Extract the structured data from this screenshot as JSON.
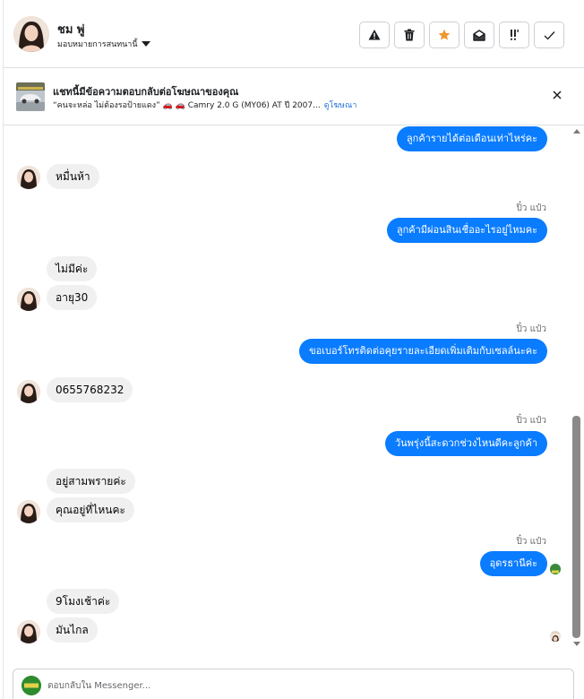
{
  "header": {
    "contact_name": "ชม พู่",
    "assign_label": "มอบหมายการสนทนานี้"
  },
  "ad_banner": {
    "title": "แชทนี้มีข้อความตอบกลับต่อโฆษณาของคุณ",
    "subtitle": "“คนจะหล่อ ไม่ต้องรอป้ายแดง” 🚗 🚗 Camry 2.0 G (MY06) AT ปี 2007...",
    "link": "ดูโฆษณา"
  },
  "messages": [
    {
      "id": "m1",
      "dir": "out",
      "text": "ลูกค้ารายได้ต่อเดือนเท่าไหร่คะ"
    },
    {
      "id": "m2",
      "dir": "in",
      "text": "หมื่นห้า"
    },
    {
      "id": "m3",
      "dir": "out",
      "sender": "ปิ๋ว แป๋ว",
      "text": "ลูกค้ามีผ่อนสินเชื่ออะไรอยู่ไหมคะ"
    },
    {
      "id": "m4",
      "dir": "in",
      "text": "ไม่มีค่ะ"
    },
    {
      "id": "m5",
      "dir": "in",
      "text": "อายุ30"
    },
    {
      "id": "m6",
      "dir": "out",
      "sender": "ปิ๋ว แป๋ว",
      "text": "ขอเบอร์โทรติดต่อคุยรายละเอียดเพิ่มเติมกับเซลล์นะคะ"
    },
    {
      "id": "m7",
      "dir": "in",
      "text": "0655768232"
    },
    {
      "id": "m8",
      "dir": "out",
      "sender": "ปิ๋ว แป๋ว",
      "text": "วันพรุ่งนี้สะดวกช่วงไหนดีคะลูกค้า"
    },
    {
      "id": "m9",
      "dir": "in",
      "text": "อยู่สามพรายค่ะ"
    },
    {
      "id": "m10",
      "dir": "in",
      "text": "คุณอยู่ที่ไหนคะ"
    },
    {
      "id": "m11",
      "dir": "out",
      "sender": "ปิ๋ว แป๋ว",
      "text": "อุดรธานีค่ะ"
    },
    {
      "id": "m12",
      "dir": "in",
      "text": "9โมงเช้าค่ะ"
    },
    {
      "id": "m13",
      "dir": "in",
      "text": "มันไกล"
    }
  ],
  "composer": {
    "placeholder": "ตอบกลับใน Messenger..."
  },
  "icons": {
    "toolbar": [
      "alert-icon",
      "trash-icon",
      "star-icon",
      "mark-unread-icon",
      "follow-up-icon",
      "check-icon"
    ],
    "star_color": "#f0952f",
    "outgoing_bubble_color": "#0a7cff"
  }
}
